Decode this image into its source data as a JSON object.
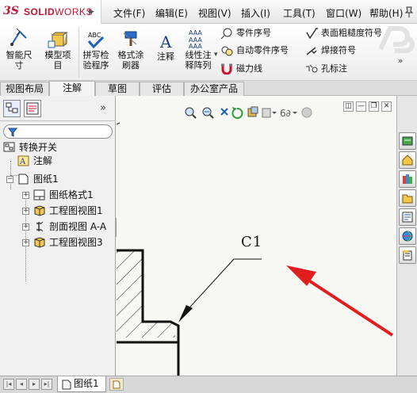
{
  "app": {
    "logo_ds": "3S",
    "logo_solid": "SOLID",
    "logo_works": "WORKS",
    "logo_menu_arrow": "▶"
  },
  "menu": {
    "items": [
      "文件(F)",
      "编辑(E)",
      "视图(V)",
      "插入(I)",
      "工具(T)",
      "窗口(W)",
      "帮助(H)"
    ],
    "pin_icon": "pin-icon"
  },
  "ribbon": {
    "smart_dimension": [
      "智能尺",
      "寸"
    ],
    "model_items": [
      "模型项",
      "目"
    ],
    "spell_check": [
      "拼写检",
      "验程序"
    ],
    "format_painter": [
      "格式涂",
      "刷器"
    ],
    "note": "注释",
    "linear_note_pattern": [
      "线性注",
      "释阵列"
    ],
    "balloon": "零件序号",
    "auto_balloon": "自动零件序号",
    "magnetic_line": "磁力线",
    "surface_finish": "表面粗糙度符号",
    "weld_symbol": "焊接符号",
    "hole_callout": "孔标注",
    "abc_label": "ABC",
    "text_a": "A",
    "more_arrow": "▾"
  },
  "tabs": {
    "items": [
      "视图布局",
      "注解",
      "草图",
      "评估",
      "办公室产品"
    ],
    "active": "注解"
  },
  "feature_tree": {
    "more_label": "»",
    "items": [
      {
        "label": "转换开关",
        "icon": "drawing-icon"
      },
      {
        "label": "注解",
        "icon": "annotation-folder-icon"
      },
      {
        "label": "图纸1",
        "icon": "sheet-icon"
      },
      {
        "label": "图纸格式1",
        "icon": "sheet-format-icon"
      },
      {
        "label": "工程图视图1",
        "icon": "drawing-view-icon"
      },
      {
        "label": "剖面视图 A-A",
        "icon": "section-view-icon"
      },
      {
        "label": "工程图视图3",
        "icon": "drawing-view-icon"
      }
    ],
    "expand_symbol": "+",
    "collapse_symbol": "−",
    "splitter_arrow": "◂"
  },
  "canvas": {
    "chamfer_note": "C1",
    "highlight_color": "#e01e1e",
    "win_controls": [
      "◫",
      "—",
      "❐",
      "✕"
    ]
  },
  "bottom_bar": {
    "sheet_tab": "图纸1",
    "nav_buttons": [
      "|◂",
      "◂",
      "▸",
      "▸|"
    ]
  },
  "colors": {
    "brand_red": "#c8102e",
    "accent_blue": "#1d5fbf"
  }
}
